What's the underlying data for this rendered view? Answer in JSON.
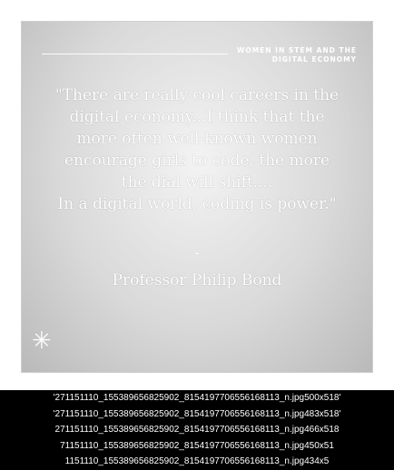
{
  "card": {
    "brand_line1": "WOMEN IN STEM AND THE",
    "brand_line2": "DIGITAL ECONOMY",
    "quote_lines": [
      "\"There are really cool careers in the",
      "digital economy...I think that the",
      "more often well-known women",
      "encourage girls to code, the more",
      "the dial will shift....",
      "In a digital world, coding is power.\""
    ],
    "dash": "-",
    "author": "Professor Philip Bond",
    "star_glyph": "✳"
  },
  "captions": [
    "'271151110_155389656825902_8154197706556168113_n.jpg500x518'",
    "'271151110_155389656825902_8154197706556168113_n.jpg483x518'",
    "271151110_155389656825902_8154197706556168113_n.jpg466x518",
    "71151110_155389656825902_8154197706556168113_n.jpg450x51",
    "1151110_155389656825902_8154197706556168113_n.jpg434x5"
  ]
}
